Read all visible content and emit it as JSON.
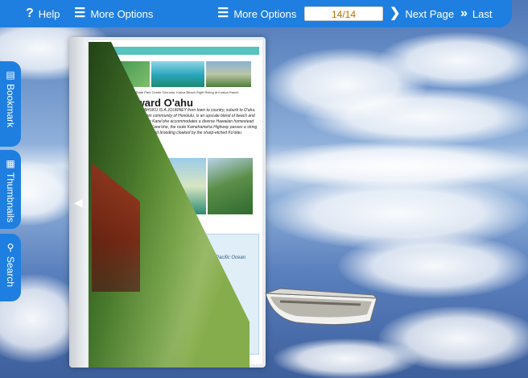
{
  "toolbar": {
    "help_label": "Help",
    "more_options_label": "More Options",
    "more_options_label_2": "More Options",
    "page_indicator": "14/14",
    "next_page_label": "Next Page",
    "last_label": "Last"
  },
  "sidebar": {
    "items": [
      {
        "label": "Bookmark",
        "icon": "bookmark-icon"
      },
      {
        "label": "Thumbnails",
        "icon": "thumbnails-icon"
      },
      {
        "label": "Search",
        "icon": "search-icon"
      }
    ]
  },
  "page": {
    "caption": "Left Fishpond, Hale'a State Park Center Grounds, Kailua Beach Right Riding at Kualoa Ranch",
    "heading": "Windward O'ahu",
    "body": "KAILUA TO KAHUKU IS A JOURNEY from town to country, suburb to O'ahu. Kailua, a bedroom community of Honolulu, is an upscale blend of beach and lake homes, while Kane'ohe accommodates a diverse Hawaiian homestead lands. North from Kane'ohe, the route Kamehameha Highway passes a string of sandy beaches and brooding cloaked by the sharp-etched Ko'olau Mountain Range.",
    "ocean_label": "Pacific Ocean"
  },
  "colors": {
    "toolbar": "#1f7fe0",
    "page_indicator_text": "#c07000",
    "stripe": "#57c3be"
  }
}
